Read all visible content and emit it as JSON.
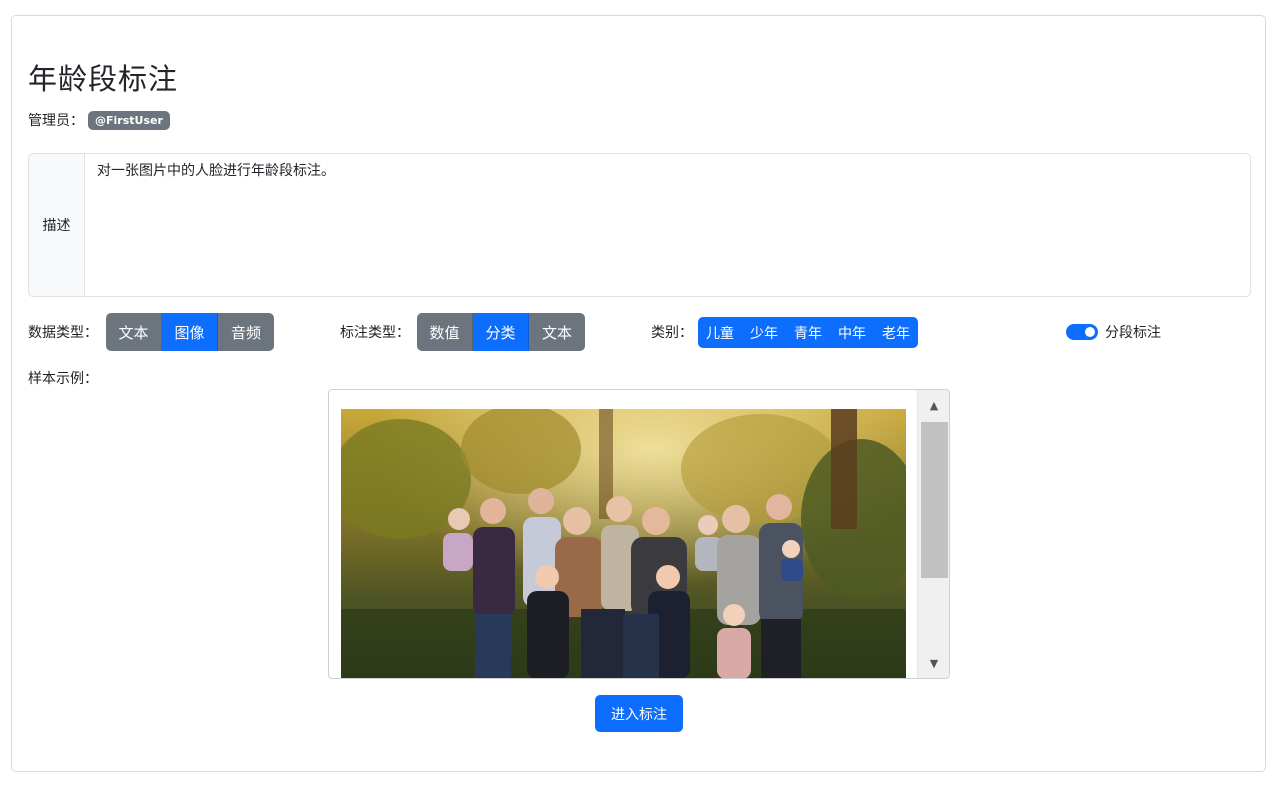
{
  "page": {
    "title": "年龄段标注",
    "admin_label": "管理员：",
    "admin_user": "@FirstUser"
  },
  "description": {
    "label": "描述",
    "text": "对一张图片中的人脸进行年龄段标注。"
  },
  "data_type": {
    "label": "数据类型：",
    "options": [
      "文本",
      "图像",
      "音频"
    ],
    "selected": "图像"
  },
  "annotation_type": {
    "label": "标注类型：",
    "options": [
      "数值",
      "分类",
      "文本"
    ],
    "selected": "分类"
  },
  "categories": {
    "label": "类别：",
    "items": [
      "儿童",
      "少年",
      "青年",
      "中年",
      "老年"
    ]
  },
  "segment_toggle": {
    "label": "分段标注",
    "checked": true
  },
  "sample": {
    "label": "样本示例："
  },
  "enter_button": {
    "label": "进入标注"
  },
  "colors": {
    "primary": "#0d6efd",
    "secondary": "#6c757d"
  },
  "icons": {
    "scroll_up": "triangle-up-icon",
    "scroll_down": "triangle-down-icon"
  }
}
